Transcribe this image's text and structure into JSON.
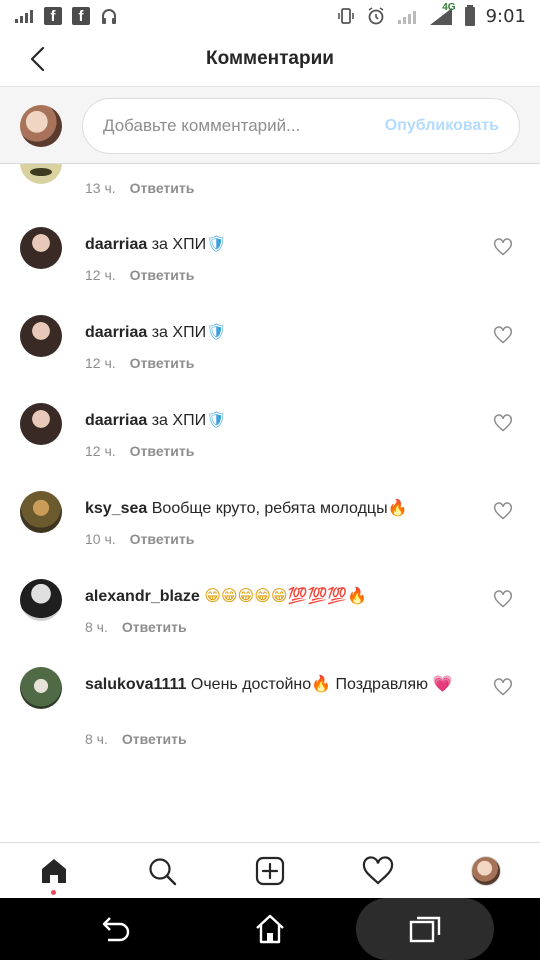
{
  "status_bar": {
    "time": "9:01",
    "network_label": "4G",
    "left_icons": [
      "signal-bars-icon",
      "facebook-icon",
      "facebook-icon",
      "headphones-icon"
    ],
    "right_icons": [
      "vibrate-icon",
      "alarm-icon",
      "wifi-icon",
      "cell-signal-icon",
      "battery-icon"
    ]
  },
  "header": {
    "title": "Комментарии"
  },
  "composer": {
    "placeholder": "Добавьте комментарий...",
    "publish_label": "Опубликовать"
  },
  "partial_comment": {
    "time": "13 ч.",
    "reply_label": "Ответить"
  },
  "comments": [
    {
      "username": "daarriaa",
      "text": "за ХПИ",
      "emoji": "🛡",
      "time": "12 ч.",
      "reply_label": "Ответить",
      "avatar_color": "#3a2a26"
    },
    {
      "username": "daarriaa",
      "text": "за ХПИ",
      "emoji": "🛡",
      "time": "12 ч.",
      "reply_label": "Ответить",
      "avatar_color": "#3a2a26"
    },
    {
      "username": "daarriaa",
      "text": "за ХПИ",
      "emoji": "🛡",
      "time": "12 ч.",
      "reply_label": "Ответить",
      "avatar_color": "#3a2a26"
    },
    {
      "username": "ksy_sea",
      "text": "Вообще круто, ребята молодцы",
      "emoji": "🔥",
      "time": "10 ч.",
      "reply_label": "Ответить",
      "avatar_color": "#6b5a2e"
    },
    {
      "username": "alexandr_blaze",
      "text": "",
      "emoji": "😁😁😁😁😁💯💯💯🔥",
      "time": "8 ч.",
      "reply_label": "Ответить",
      "avatar_color": "#1f1f1f"
    },
    {
      "username": "salukova1111",
      "text": "Очень достойно",
      "emoji": "🔥",
      "text2": " Поздравляю",
      "emoji2": "💗",
      "time": "8 ч.",
      "reply_label": "Ответить",
      "avatar_color": "#4f6a45"
    }
  ],
  "bottom_nav": {
    "items": [
      "home-icon",
      "search-icon",
      "add-post-icon",
      "activity-heart-icon",
      "profile-avatar"
    ]
  },
  "android_nav": {
    "items": [
      "back-arrow-icon",
      "home-outline-icon",
      "recent-apps-icon"
    ]
  },
  "colors": {
    "publish_disabled": "#b3dbff",
    "text_primary": "#262626",
    "text_secondary": "#8e8e8e",
    "notification_dot": "#ed4956"
  }
}
